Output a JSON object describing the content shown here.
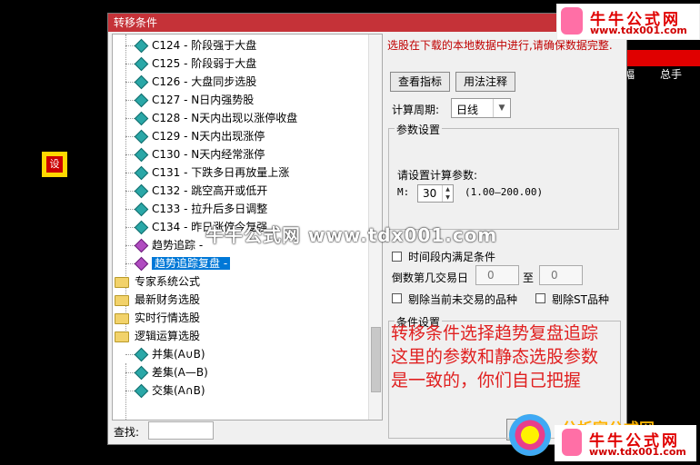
{
  "background": {
    "header_cols": [
      "幅",
      "总手"
    ],
    "marker_label": "设"
  },
  "dialog": {
    "title": "转移条件",
    "tree": {
      "items": [
        {
          "label": "C124 - 阶段强于大盘",
          "type": "formula"
        },
        {
          "label": "C125 - 阶段弱于大盘",
          "type": "formula"
        },
        {
          "label": "C126 - 大盘同步选股",
          "type": "formula"
        },
        {
          "label": "C127 - N日内强势股",
          "type": "formula"
        },
        {
          "label": "C128 - N天内出现以涨停收盘",
          "type": "formula"
        },
        {
          "label": "C129 - N天内出现涨停",
          "type": "formula"
        },
        {
          "label": "C130 - N天内经常涨停",
          "type": "formula"
        },
        {
          "label": "C131 - 下跌多日再放量上涨",
          "type": "formula"
        },
        {
          "label": "C132 - 跳空高开或低开",
          "type": "formula"
        },
        {
          "label": "C133 - 拉升后多日调整",
          "type": "formula"
        },
        {
          "label": "C134 - 昨日涨停今复强",
          "type": "formula"
        },
        {
          "label": "趋势追踪 -",
          "type": "user"
        },
        {
          "label": "趋势追踪复盘 -",
          "type": "user",
          "selected": true
        },
        {
          "label": "专家系统公式",
          "type": "folder"
        },
        {
          "label": "最新财务选股",
          "type": "folder"
        },
        {
          "label": "实时行情选股",
          "type": "folder"
        },
        {
          "label": "逻辑运算选股",
          "type": "folder"
        },
        {
          "label": "并集(A∪B)",
          "type": "formula"
        },
        {
          "label": "差集(A—B)",
          "type": "formula"
        },
        {
          "label": "交集(A∩B)",
          "type": "formula"
        }
      ]
    },
    "search_label": "查找:",
    "search_value": "",
    "notice": "选股在下载的本地数据中进行,请确保数据完整.",
    "buttons": {
      "view_indicator": "查看指标",
      "usage_notes": "用法注释"
    },
    "period_label": "计算周期:",
    "period_value": "日线",
    "params_group": {
      "title": "参数设置",
      "prompt": "请设置计算参数:",
      "param_name": "M:",
      "param_value": "30",
      "param_range": "(1.00—200.00)"
    },
    "range_group": {
      "checkbox_label": "时间段内满足条件",
      "from_label": "倒数第几交易日",
      "from_value": "0",
      "to_label": "至",
      "to_value": "0"
    },
    "exclude_suspended": "剔除当前未交易的品种",
    "exclude_st": "剔除ST品种",
    "condition_group_title": "条件设置",
    "annotation_lines": [
      "转移条件选择趋势复盘追踪",
      "这里的参数和静态选股参数",
      "是一致的，你们自己把握"
    ]
  },
  "watermark": "牛牛公式网 www.tdx001.com",
  "logos": {
    "top_name": "牛牛公式网",
    "top_url": "www.tdx001.com",
    "bottom_caption": "分析家公式网",
    "bottom_name": "牛牛公式网",
    "bottom_url": "www.tdx001.com"
  }
}
